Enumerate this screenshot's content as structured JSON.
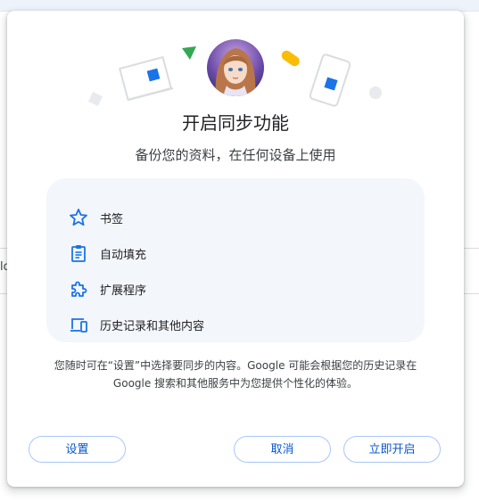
{
  "background": {
    "partial_text": "ld"
  },
  "dialog": {
    "title": "开启同步功能",
    "subtitle": "备份您的资料，在任何设备上使用",
    "features": [
      {
        "icon": "star-icon",
        "label": "书签"
      },
      {
        "icon": "clipboard-icon",
        "label": "自动填充"
      },
      {
        "icon": "puzzle-icon",
        "label": "扩展程序"
      },
      {
        "icon": "devices-icon",
        "label": "历史记录和其他内容"
      }
    ],
    "note_line1": "您随时可在“设置”中选择要同步的内容。Google 可能会根据您的历史记录在",
    "note_line2": "Google 搜索和其他服务中为您提供个性化的体验。",
    "buttons": {
      "settings": "设置",
      "cancel": "取消",
      "confirm": "立即开启"
    }
  },
  "colors": {
    "accent": "#0b57d0",
    "icon_blue": "#1a73e8",
    "feature_bg": "#f3f6fb",
    "button_border": "#a8c7fa",
    "green_triangle": "#34a853",
    "yellow_pill": "#fbbc04"
  }
}
